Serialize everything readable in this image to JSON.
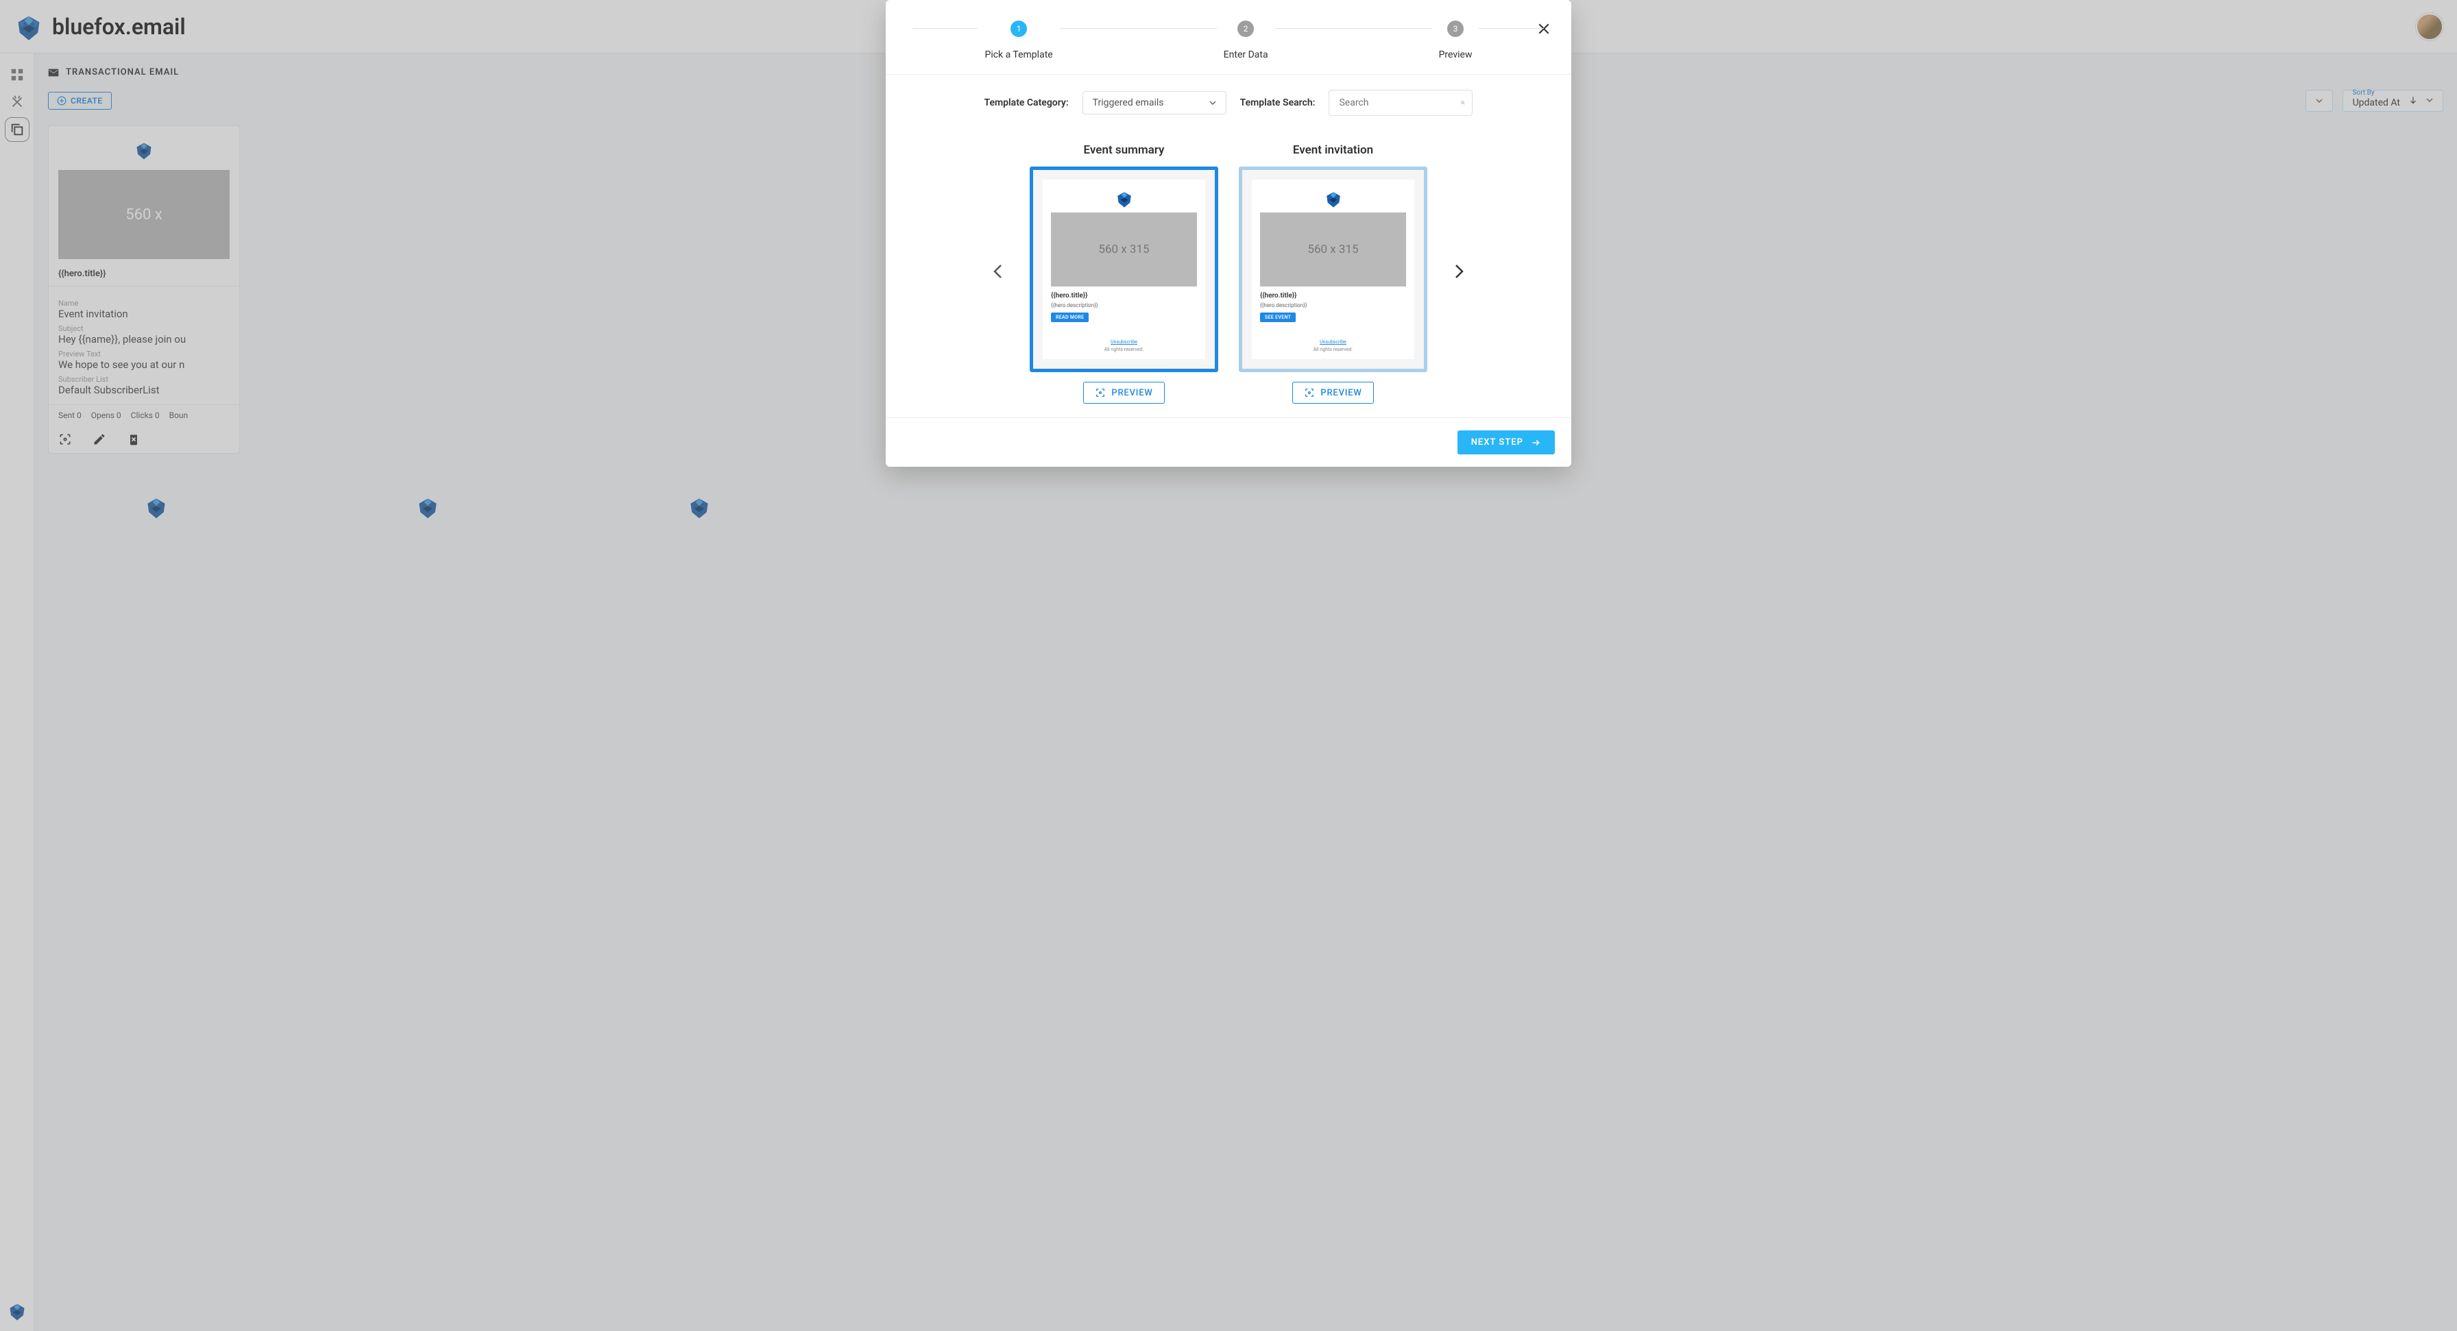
{
  "brand": "bluefox.email",
  "section_title": "TRANSACTIONAL EMAIL",
  "toolbar": {
    "create_label": "CREATE",
    "sort_label": "Sort By",
    "sort_value": "Updated At"
  },
  "card": {
    "placeholder_size": "560 x",
    "hero_title": "{{hero.title}}",
    "fields": {
      "name_label": "Name",
      "name_value": "Event invitation",
      "subject_label": "Subject",
      "subject_value": "Hey {{name}}, please join ou",
      "preview_label": "Preview Text",
      "preview_value": "We hope to see you at our n",
      "list_label": "Subscriber List",
      "list_value": "Default SubscriberList"
    },
    "stats": {
      "sent": "Sent 0",
      "opens": "Opens 0",
      "clicks": "Clicks 0",
      "boun": "Boun"
    }
  },
  "modal": {
    "steps": {
      "s1": "Pick a Template",
      "s2": "Enter Data",
      "s3": "Preview"
    },
    "filters": {
      "category_label": "Template Category:",
      "category_value": "Triggered emails",
      "search_label": "Template Search:",
      "search_placeholder": "Search"
    },
    "templates": {
      "t1": {
        "title": "Event summary",
        "img_size": "560 x 315",
        "hero_title": "{{hero.title}}",
        "hero_desc": "{{hero.description}}",
        "btn": "READ MORE",
        "unsub": "Unsubscribe",
        "rights": "All rights reserved."
      },
      "t2": {
        "title": "Event invitation",
        "img_size": "560 x 315",
        "hero_title": "{{hero.title}}",
        "hero_desc": "{{hero.description}}",
        "btn": "SEE EVENT",
        "unsub": "Unsubscribe",
        "rights": "All rights reserved."
      }
    },
    "preview_btn": "PREVIEW",
    "next_btn": "NEXT STEP"
  }
}
